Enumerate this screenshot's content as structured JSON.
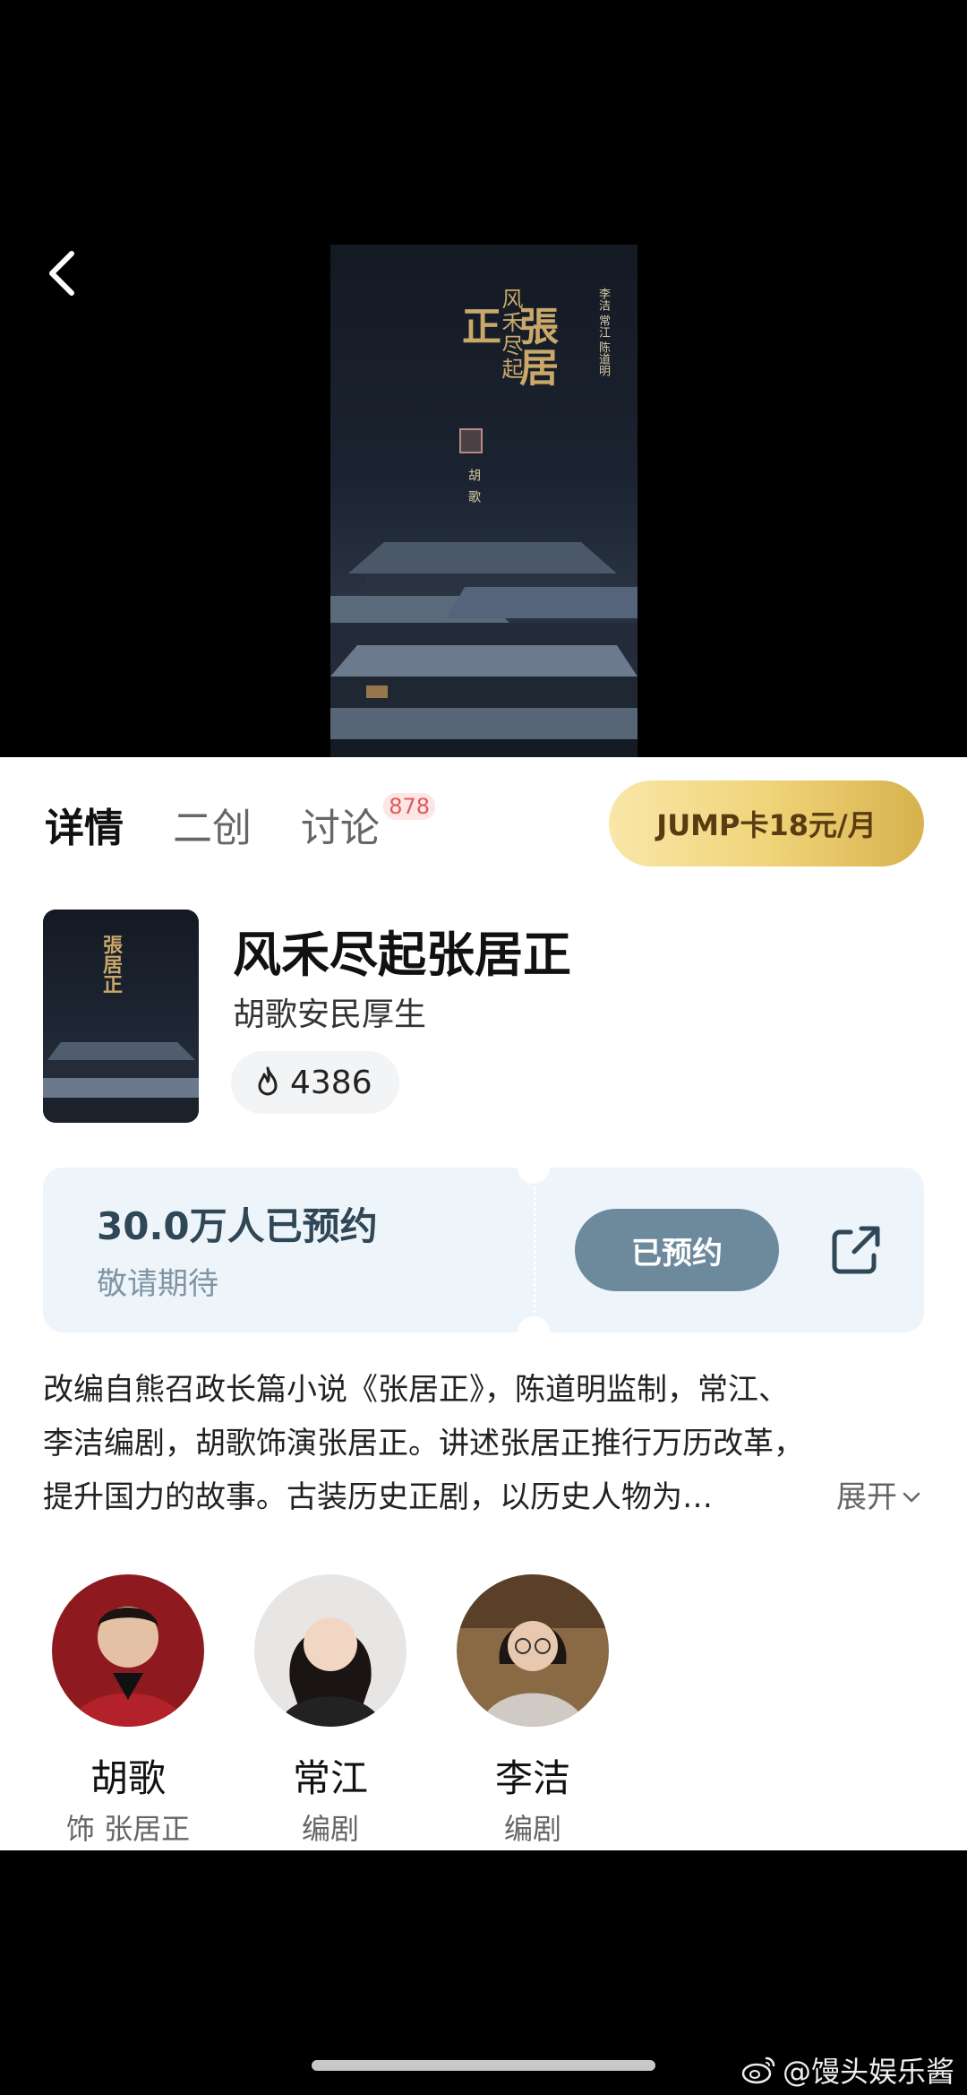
{
  "poster": {
    "title_main": "張居正",
    "title_sub": "风禾尽起",
    "credits": "李洁 常江 陈道明",
    "actor": "胡歌"
  },
  "tabs": [
    {
      "label": "详情",
      "active": true
    },
    {
      "label": "二创",
      "active": false
    },
    {
      "label": "讨论",
      "active": false,
      "badge": "878"
    }
  ],
  "membership": {
    "label": "JUMP卡18元/月"
  },
  "show": {
    "title": "风禾尽起张居正",
    "subtitle": "胡歌安民厚生",
    "heat": "4386",
    "thumb_title": "張居正"
  },
  "reservation": {
    "count_text": "30.0万人已预约",
    "sub_text": "敬请期待",
    "button_label": "已预约"
  },
  "description": {
    "lines": [
      "改编自熊召政长篇小说《张居正》，陈道明监制，常江、",
      "李洁编剧，胡歌饰演张居正。讲述张居正推行万历改革，",
      "提升国力的故事。古装历史正剧，以历史人物为…"
    ],
    "expand_label": "展开"
  },
  "cast": [
    {
      "name": "胡歌",
      "role": "饰 张居正"
    },
    {
      "name": "常江",
      "role": "编剧"
    },
    {
      "name": "李洁",
      "role": "编剧"
    }
  ],
  "watermark": {
    "text": "@馒头娱乐酱"
  },
  "colors": {
    "accent_gold": "#f0d479",
    "reserved_button": "#6d8a9c",
    "reserve_card_bg": "#eef5fa",
    "badge_red": "#e05a5a"
  },
  "icons": [
    "back-icon",
    "flame-icon",
    "share-icon",
    "chevron-down-icon",
    "weibo-icon"
  ]
}
